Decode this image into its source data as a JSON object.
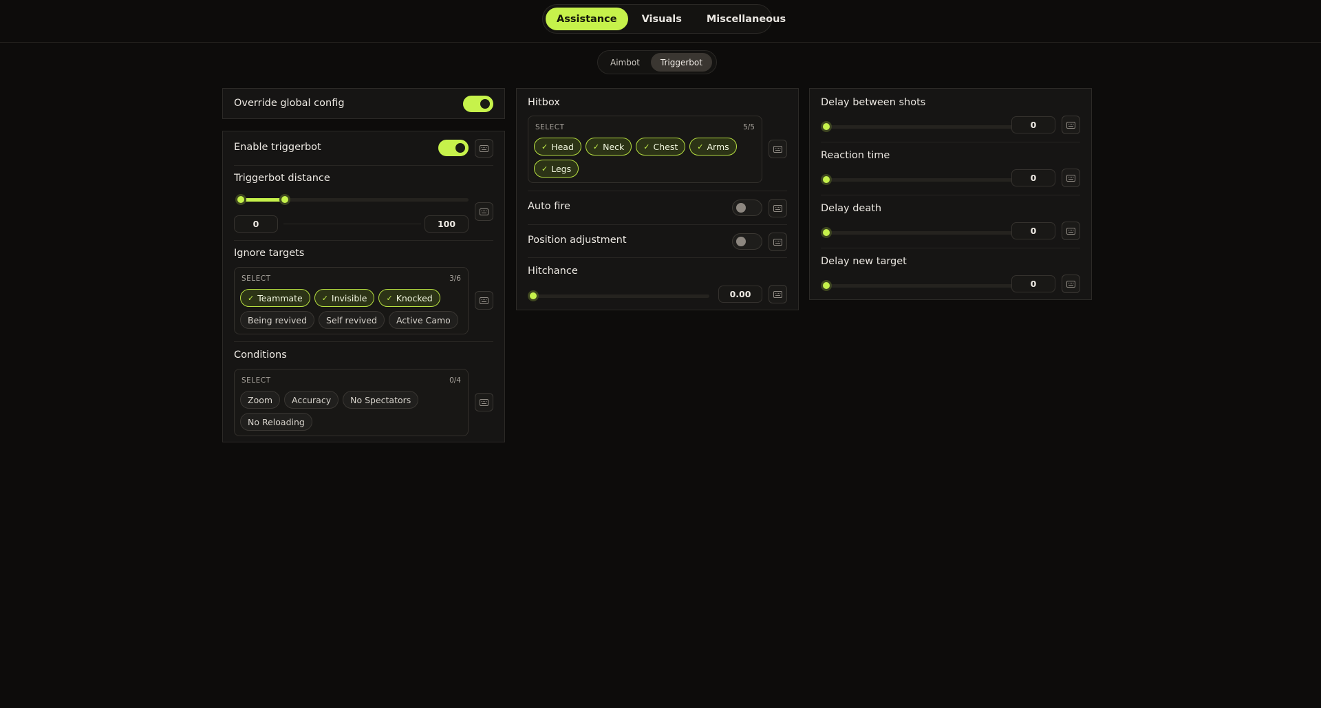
{
  "topnav": {
    "tabs": [
      "Assistance",
      "Visuals",
      "Miscellaneous"
    ],
    "active": 0
  },
  "subnav": {
    "tabs": [
      "Aimbot",
      "Triggerbot"
    ],
    "active": 1
  },
  "override": {
    "label": "Override global config",
    "enabled": true
  },
  "triggerbot": {
    "enable_label": "Enable triggerbot",
    "enabled": true,
    "distance": {
      "label": "Triggerbot distance",
      "min_value": "0",
      "max_value": "100",
      "range_fraction": [
        0.0,
        0.19
      ]
    },
    "ignore_targets": {
      "label": "Ignore targets",
      "select_title": "SELECT",
      "count": "3/6",
      "options": [
        {
          "name": "Teammate",
          "selected": true
        },
        {
          "name": "Invisible",
          "selected": true
        },
        {
          "name": "Knocked",
          "selected": true
        },
        {
          "name": "Being revived",
          "selected": false
        },
        {
          "name": "Self revived",
          "selected": false
        },
        {
          "name": "Active Camo",
          "selected": false
        }
      ]
    },
    "conditions": {
      "label": "Conditions",
      "select_title": "SELECT",
      "count": "0/4",
      "options": [
        {
          "name": "Zoom",
          "selected": false
        },
        {
          "name": "Accuracy",
          "selected": false
        },
        {
          "name": "No Spectators",
          "selected": false
        },
        {
          "name": "No Reloading",
          "selected": false
        }
      ]
    }
  },
  "hitbox": {
    "label": "Hitbox",
    "select_title": "SELECT",
    "count": "5/5",
    "options": [
      {
        "name": "Head",
        "selected": true
      },
      {
        "name": "Neck",
        "selected": true
      },
      {
        "name": "Chest",
        "selected": true
      },
      {
        "name": "Arms",
        "selected": true
      },
      {
        "name": "Legs",
        "selected": true
      }
    ]
  },
  "auto_fire": {
    "label": "Auto fire",
    "enabled": false
  },
  "position_adjustment": {
    "label": "Position adjustment",
    "enabled": false
  },
  "hitchance": {
    "label": "Hitchance",
    "value": "0.00",
    "fraction": 0.0
  },
  "delays": {
    "between_shots": {
      "label": "Delay between shots",
      "value": "0",
      "fraction": 0.0
    },
    "reaction_time": {
      "label": "Reaction time",
      "value": "0",
      "fraction": 0.0
    },
    "death": {
      "label": "Delay death",
      "value": "0",
      "fraction": 0.0
    },
    "new_target": {
      "label": "Delay new target",
      "value": "0",
      "fraction": 0.0
    }
  },
  "colors": {
    "accent": "#c6f24b",
    "background": "#0d0c0b",
    "panel": "#161514"
  },
  "icons": {
    "keybind": "keyboard-icon",
    "check": "check-icon"
  }
}
